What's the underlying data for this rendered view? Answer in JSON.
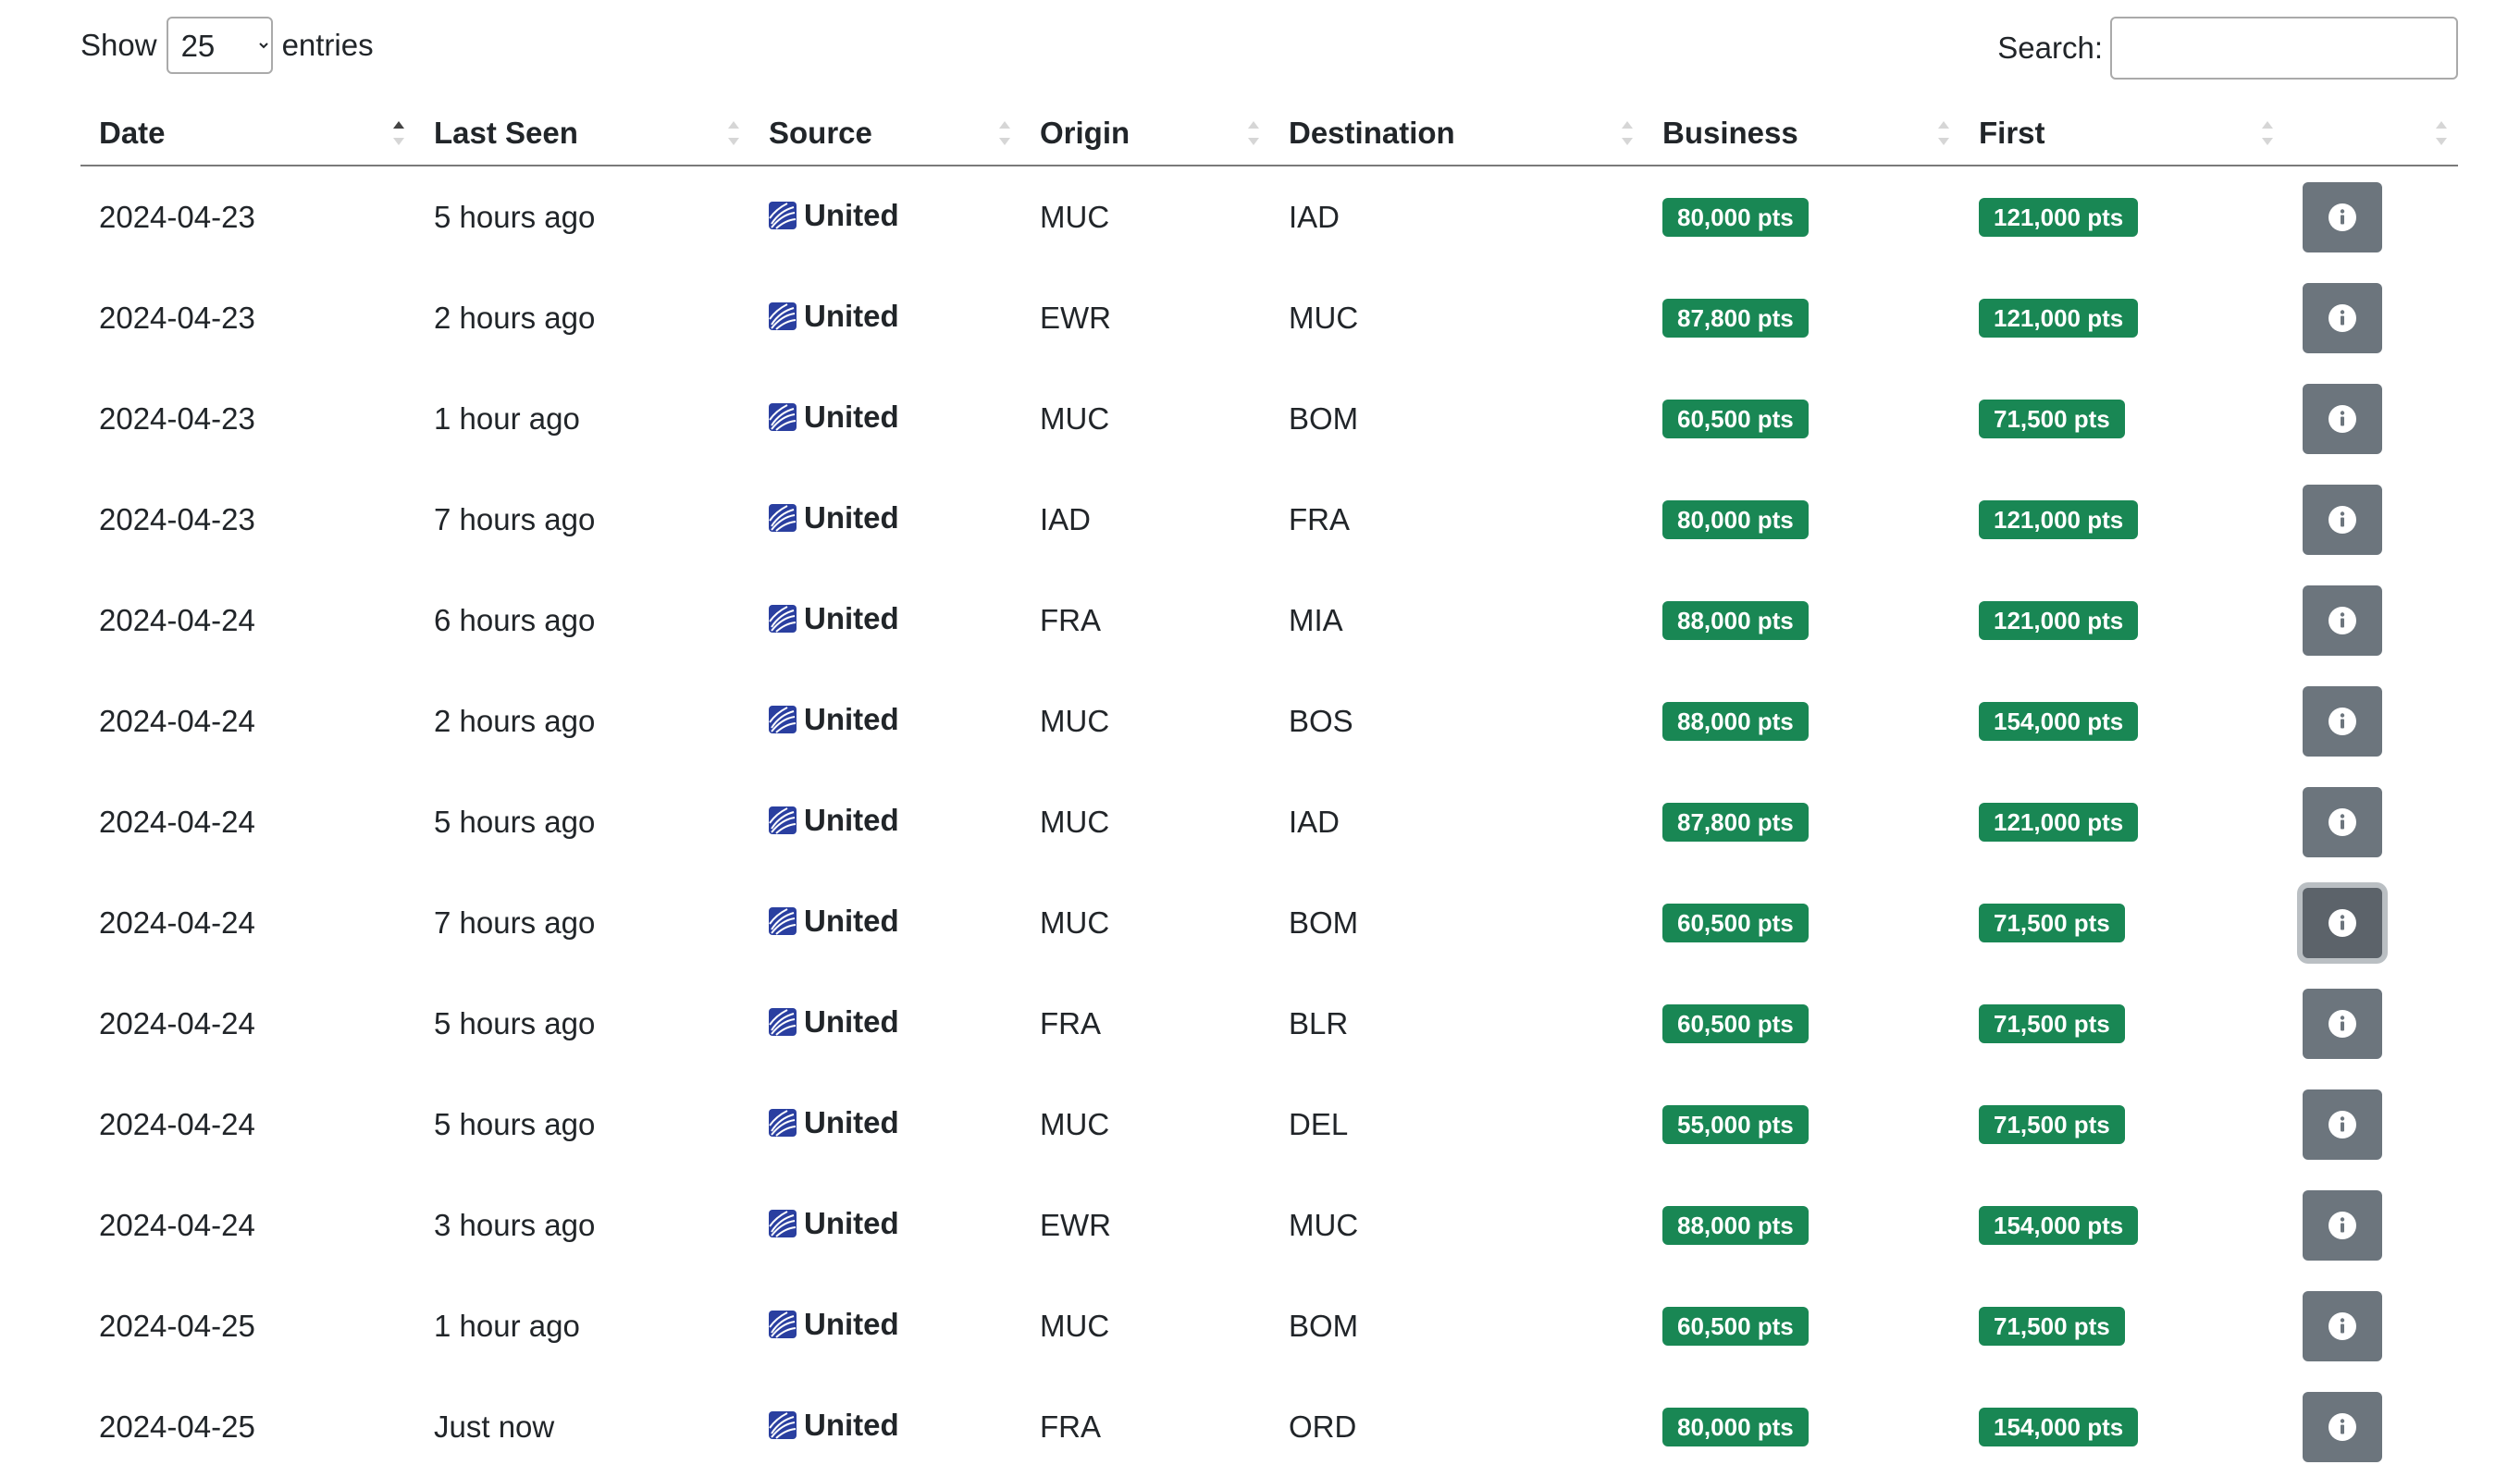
{
  "controls": {
    "show_label": "Show",
    "entries_label": "entries",
    "page_length": "25",
    "search_label": "Search:",
    "search_value": ""
  },
  "columns": [
    "Date",
    "Last Seen",
    "Source",
    "Origin",
    "Destination",
    "Business",
    "First",
    ""
  ],
  "sort": {
    "column": "Date",
    "direction": "ascending"
  },
  "colors": {
    "badge": "#198754",
    "button": "#6c757d",
    "logo": "#2a3fa0"
  },
  "icons": {
    "source_logo": "united-logo-icon",
    "row_action": "info-icon",
    "select": "chevron-down-icon"
  },
  "rows": [
    {
      "date": "2024-04-23",
      "last_seen": "5 hours ago",
      "source": "United",
      "origin": "MUC",
      "destination": "IAD",
      "business": "80,000 pts",
      "first": "121,000 pts"
    },
    {
      "date": "2024-04-23",
      "last_seen": "2 hours ago",
      "source": "United",
      "origin": "EWR",
      "destination": "MUC",
      "business": "87,800 pts",
      "first": "121,000 pts"
    },
    {
      "date": "2024-04-23",
      "last_seen": "1 hour ago",
      "source": "United",
      "origin": "MUC",
      "destination": "BOM",
      "business": "60,500 pts",
      "first": "71,500 pts"
    },
    {
      "date": "2024-04-23",
      "last_seen": "7 hours ago",
      "source": "United",
      "origin": "IAD",
      "destination": "FRA",
      "business": "80,000 pts",
      "first": "121,000 pts"
    },
    {
      "date": "2024-04-24",
      "last_seen": "6 hours ago",
      "source": "United",
      "origin": "FRA",
      "destination": "MIA",
      "business": "88,000 pts",
      "first": "121,000 pts"
    },
    {
      "date": "2024-04-24",
      "last_seen": "2 hours ago",
      "source": "United",
      "origin": "MUC",
      "destination": "BOS",
      "business": "88,000 pts",
      "first": "154,000 pts"
    },
    {
      "date": "2024-04-24",
      "last_seen": "5 hours ago",
      "source": "United",
      "origin": "MUC",
      "destination": "IAD",
      "business": "87,800 pts",
      "first": "121,000 pts"
    },
    {
      "date": "2024-04-24",
      "last_seen": "7 hours ago",
      "source": "United",
      "origin": "MUC",
      "destination": "BOM",
      "business": "60,500 pts",
      "first": "71,500 pts",
      "focused": true
    },
    {
      "date": "2024-04-24",
      "last_seen": "5 hours ago",
      "source": "United",
      "origin": "FRA",
      "destination": "BLR",
      "business": "60,500 pts",
      "first": "71,500 pts"
    },
    {
      "date": "2024-04-24",
      "last_seen": "5 hours ago",
      "source": "United",
      "origin": "MUC",
      "destination": "DEL",
      "business": "55,000 pts",
      "first": "71,500 pts"
    },
    {
      "date": "2024-04-24",
      "last_seen": "3 hours ago",
      "source": "United",
      "origin": "EWR",
      "destination": "MUC",
      "business": "88,000 pts",
      "first": "154,000 pts"
    },
    {
      "date": "2024-04-25",
      "last_seen": "1 hour ago",
      "source": "United",
      "origin": "MUC",
      "destination": "BOM",
      "business": "60,500 pts",
      "first": "71,500 pts"
    },
    {
      "date": "2024-04-25",
      "last_seen": "Just now",
      "source": "United",
      "origin": "FRA",
      "destination": "ORD",
      "business": "80,000 pts",
      "first": "154,000 pts"
    }
  ]
}
